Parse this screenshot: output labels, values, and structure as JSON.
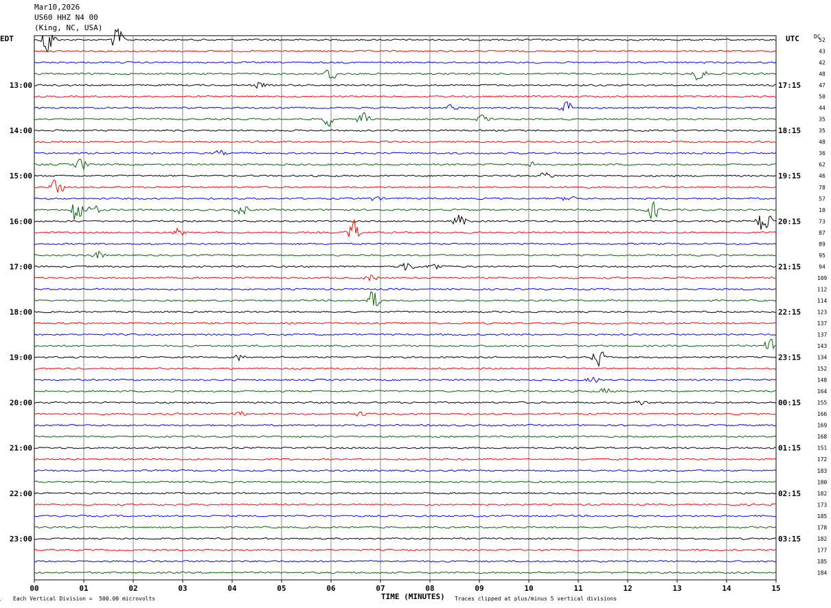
{
  "header": {
    "date": "Mar10,2026",
    "station": "US60 HHZ N4 00",
    "location": "(King, NC, USA)"
  },
  "left_axis_label": "EDT",
  "right_axis_label": "UTC",
  "dc_label": "DC",
  "x_axis_title": "TIME (MINUTES)",
  "footer_left": "Each Vertical Division =  500.00 microvolts",
  "footer_right": "Traces clipped at plus/minus 5 vertical divisions",
  "chart_data": {
    "type": "line",
    "title": "",
    "xlabel": "TIME (MINUTES)",
    "xlim": [
      0,
      15
    ],
    "x_ticks": [
      "00",
      "01",
      "02",
      "03",
      "04",
      "05",
      "06",
      "07",
      "08",
      "09",
      "10",
      "11",
      "12",
      "13",
      "14",
      "15"
    ],
    "grid": true,
    "trace_count": 48,
    "trace_colors": [
      "#000000",
      "#ff0000",
      "#0000ff",
      "#006400"
    ],
    "left_time_labels": [
      "13:00",
      "14:00",
      "15:00",
      "16:00",
      "17:00",
      "18:00",
      "19:00",
      "20:00",
      "21:00",
      "22:00",
      "23:00"
    ],
    "right_time_labels": [
      "17:15",
      "18:15",
      "19:15",
      "20:15",
      "21:15",
      "22:15",
      "23:15",
      "00:15",
      "01:15",
      "02:15",
      "03:15"
    ],
    "dc_offsets": [
      52,
      43,
      42,
      48,
      47,
      50,
      44,
      35,
      35,
      48,
      36,
      62,
      46,
      78,
      57,
      10,
      73,
      87,
      89,
      95,
      94,
      109,
      112,
      114,
      123,
      137,
      137,
      143,
      134,
      152,
      148,
      164,
      155,
      166,
      169,
      168,
      151,
      172,
      183,
      180,
      182,
      173,
      185,
      178,
      182,
      177,
      185,
      184
    ],
    "events": [
      {
        "trace": 0,
        "minute": 0.28,
        "amp": 3.5
      },
      {
        "trace": 0,
        "minute": 1.68,
        "amp": 2.5
      },
      {
        "trace": 3,
        "minute": 6.0,
        "amp": 1.5
      },
      {
        "trace": 3,
        "minute": 13.45,
        "amp": 1.5
      },
      {
        "trace": 4,
        "minute": 4.55,
        "amp": 0.6
      },
      {
        "trace": 6,
        "minute": 8.45,
        "amp": 0.6
      },
      {
        "trace": 6,
        "minute": 10.75,
        "amp": 1.6
      },
      {
        "trace": 7,
        "minute": 5.95,
        "amp": 1.3
      },
      {
        "trace": 7,
        "minute": 6.65,
        "amp": 1.3
      },
      {
        "trace": 7,
        "minute": 9.1,
        "amp": 1.2
      },
      {
        "trace": 10,
        "minute": 3.75,
        "amp": 0.5
      },
      {
        "trace": 11,
        "minute": 0.95,
        "amp": 1.2
      },
      {
        "trace": 11,
        "minute": 10.1,
        "amp": 0.6
      },
      {
        "trace": 12,
        "minute": 10.35,
        "amp": 0.7
      },
      {
        "trace": 13,
        "minute": 0.45,
        "amp": 1.8
      },
      {
        "trace": 14,
        "minute": 6.9,
        "amp": 0.5
      },
      {
        "trace": 14,
        "minute": 10.8,
        "amp": 0.6
      },
      {
        "trace": 15,
        "minute": 0.85,
        "amp": 3.5
      },
      {
        "trace": 15,
        "minute": 1.2,
        "amp": 1.0
      },
      {
        "trace": 15,
        "minute": 4.2,
        "amp": 1.2
      },
      {
        "trace": 15,
        "minute": 12.5,
        "amp": 2.0
      },
      {
        "trace": 16,
        "minute": 8.6,
        "amp": 1.4
      },
      {
        "trace": 16,
        "minute": 14.75,
        "amp": 3.5
      },
      {
        "trace": 17,
        "minute": 2.95,
        "amp": 1.2
      },
      {
        "trace": 17,
        "minute": 6.45,
        "amp": 2.5
      },
      {
        "trace": 19,
        "minute": 1.3,
        "amp": 0.8
      },
      {
        "trace": 20,
        "minute": 7.55,
        "amp": 1.0
      },
      {
        "trace": 20,
        "minute": 8.1,
        "amp": 0.8
      },
      {
        "trace": 21,
        "minute": 6.8,
        "amp": 0.6
      },
      {
        "trace": 23,
        "minute": 6.85,
        "amp": 2.2
      },
      {
        "trace": 27,
        "minute": 14.9,
        "amp": 1.8
      },
      {
        "trace": 28,
        "minute": 11.4,
        "amp": 1.8
      },
      {
        "trace": 28,
        "minute": 4.15,
        "amp": 0.6
      },
      {
        "trace": 30,
        "minute": 11.3,
        "amp": 0.6
      },
      {
        "trace": 31,
        "minute": 11.55,
        "amp": 0.6
      },
      {
        "trace": 32,
        "minute": 12.25,
        "amp": 0.5
      },
      {
        "trace": 33,
        "minute": 4.15,
        "amp": 0.5
      },
      {
        "trace": 33,
        "minute": 6.6,
        "amp": 0.4
      }
    ]
  }
}
